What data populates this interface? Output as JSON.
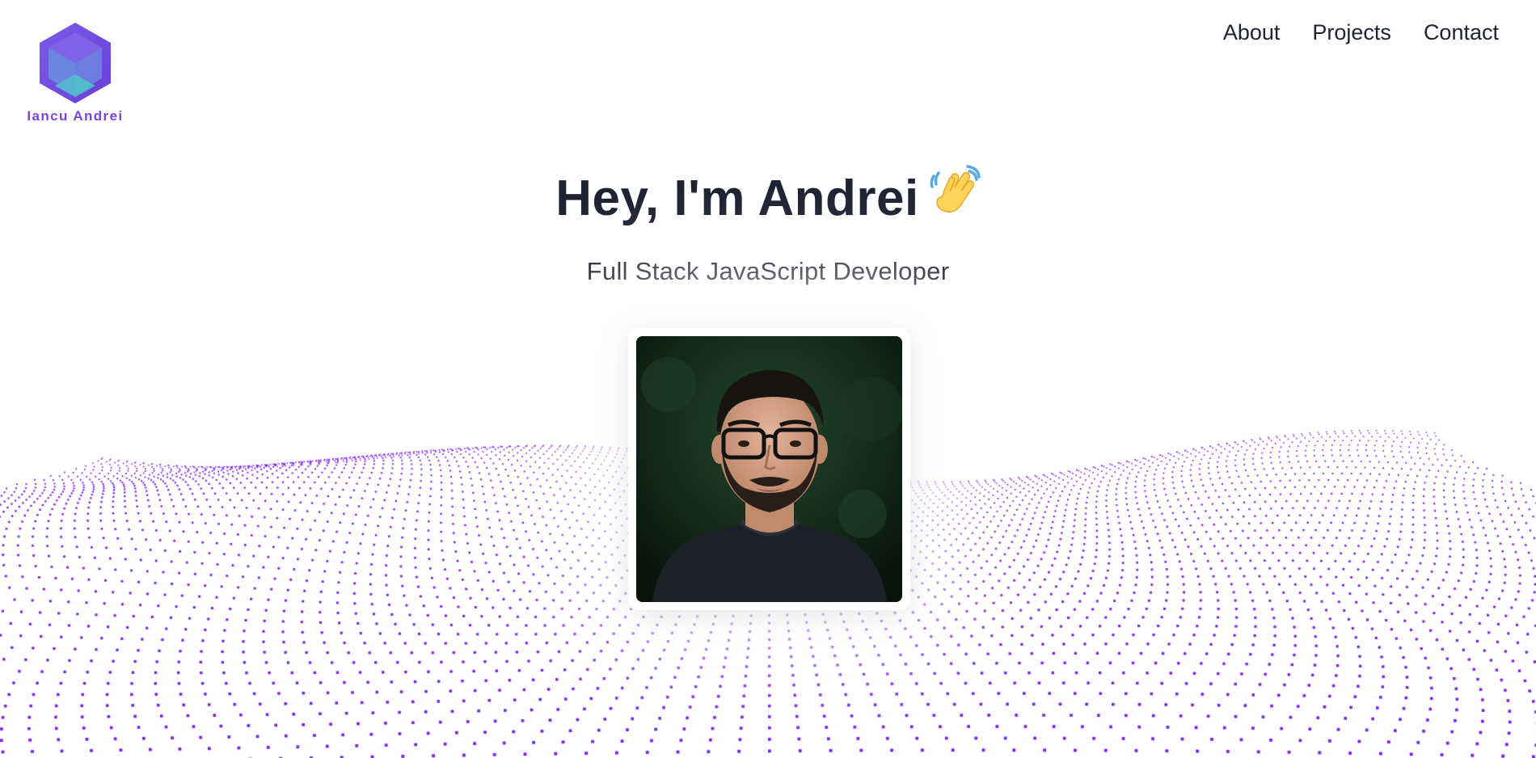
{
  "brand": {
    "name": "Iancu Andrei",
    "logo_icon": "hexagon-cube-icon",
    "color": "#7b45e0"
  },
  "nav": {
    "items": [
      {
        "label": "About"
      },
      {
        "label": "Projects"
      },
      {
        "label": "Contact"
      }
    ]
  },
  "hero": {
    "title": "Hey, I'm Andrei",
    "emoji_icon": "waving-hand-icon",
    "subtitle": "Full Stack JavaScript Developer",
    "photo_icon": "profile-photo"
  },
  "colors": {
    "text": "#1f2233",
    "accent": "#7b45e0",
    "dots": "#7a1cf0"
  }
}
